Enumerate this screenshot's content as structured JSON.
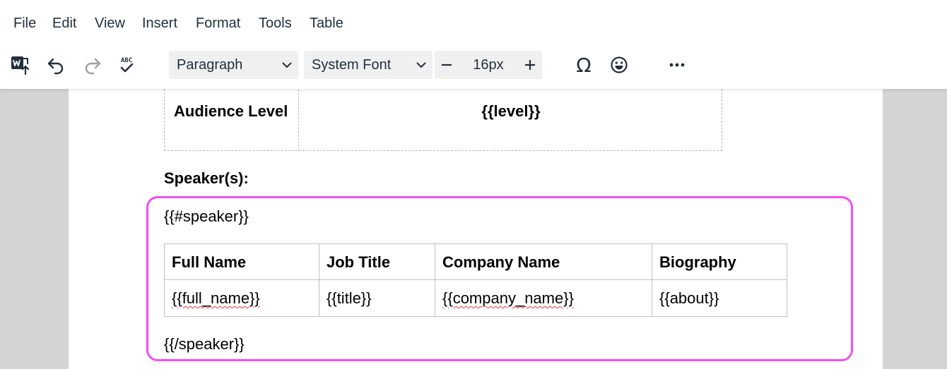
{
  "menubar": {
    "items": [
      "File",
      "Edit",
      "View",
      "Insert",
      "Format",
      "Tools",
      "Table"
    ]
  },
  "toolbar": {
    "icons": [
      "word-export-icon",
      "undo-icon",
      "redo-icon",
      "spellcheck-icon",
      "special-character-icon",
      "emoji-icon",
      "more-icon"
    ],
    "spellcheck_glyph": "ABC",
    "block_format": "Paragraph",
    "font_family": "System Font",
    "font_size": "16px",
    "special_char_glyph": "Ω"
  },
  "document": {
    "level_row": {
      "label": "Audience Level",
      "value": "{{level}}"
    },
    "speakers_heading": "Speaker(s):",
    "speaker_open": "{{#speaker}}",
    "speaker_close": "{{/speaker}}",
    "table": {
      "headers": [
        "Full Name",
        "Job Title",
        "Company Name",
        "Biography"
      ],
      "row": [
        "{{full_name}}",
        "{{title}}",
        "{{company_name}}",
        "{{about}}"
      ]
    }
  },
  "colors": {
    "highlight_border": "#ef4ff0",
    "spellcheck_underline": "#e53935"
  }
}
